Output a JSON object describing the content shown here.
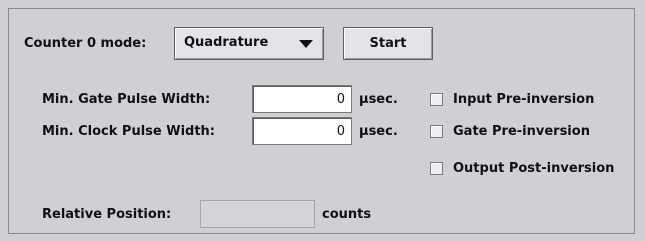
{
  "mode": {
    "label": "Counter 0 mode:",
    "selected": "Quadrature"
  },
  "start_button": "Start",
  "gate": {
    "label": "Min. Gate Pulse Width:",
    "value": "0",
    "unit": "µsec."
  },
  "clock": {
    "label": "Min. Clock Pulse Width:",
    "value": "0",
    "unit": "µsec."
  },
  "options": {
    "input_pre_inversion": "Input Pre-inversion",
    "gate_pre_inversion": "Gate Pre-inversion",
    "output_post_inversion": "Output Post-inversion"
  },
  "position": {
    "label": "Relative Position:",
    "value": "",
    "unit": "counts"
  }
}
